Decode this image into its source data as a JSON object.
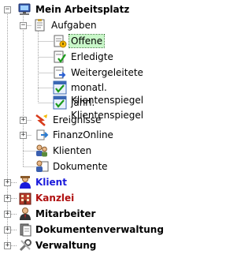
{
  "tree": {
    "root": {
      "label": "Mein Arbeitsplatz",
      "icon": "computer-icon",
      "expanded": true
    },
    "aufgaben": {
      "label": "Aufgaben",
      "icon": "task-document-icon",
      "expanded": true
    },
    "aufgaben_items": [
      {
        "label": "Offene",
        "icon": "open-task-icon",
        "selected": true
      },
      {
        "label": "Erledigte",
        "icon": "done-task-icon",
        "selected": false
      },
      {
        "label": "Weitergeleitete",
        "icon": "forwarded-task-icon",
        "selected": false
      },
      {
        "label": "monatl. Klientenspiegel",
        "icon": "checklist-icon",
        "selected": false
      },
      {
        "label": "jährl. Klientenspiegel",
        "icon": "checklist-icon",
        "selected": false
      }
    ],
    "ereignisse": {
      "label": "Ereignisse",
      "icon": "events-icon"
    },
    "finanzonline": {
      "label": "FinanzOnline",
      "icon": "finanzonline-icon"
    },
    "klienten": {
      "label": "Klienten",
      "icon": "clients-icon"
    },
    "dokumente": {
      "label": "Dokumente",
      "icon": "documents-person-icon"
    },
    "top_items": [
      {
        "label": "Klient",
        "icon": "client-person-icon",
        "color": "#1a1adb"
      },
      {
        "label": "Kanzlei",
        "icon": "office-building-icon",
        "color": "#b01010"
      },
      {
        "label": "Mitarbeiter",
        "icon": "employee-person-icon",
        "color": "#000000"
      },
      {
        "label": "Dokumentenverwaltung",
        "icon": "document-management-icon",
        "color": "#000000"
      },
      {
        "label": "Verwaltung",
        "icon": "tools-icon",
        "color": "#000000"
      }
    ]
  }
}
